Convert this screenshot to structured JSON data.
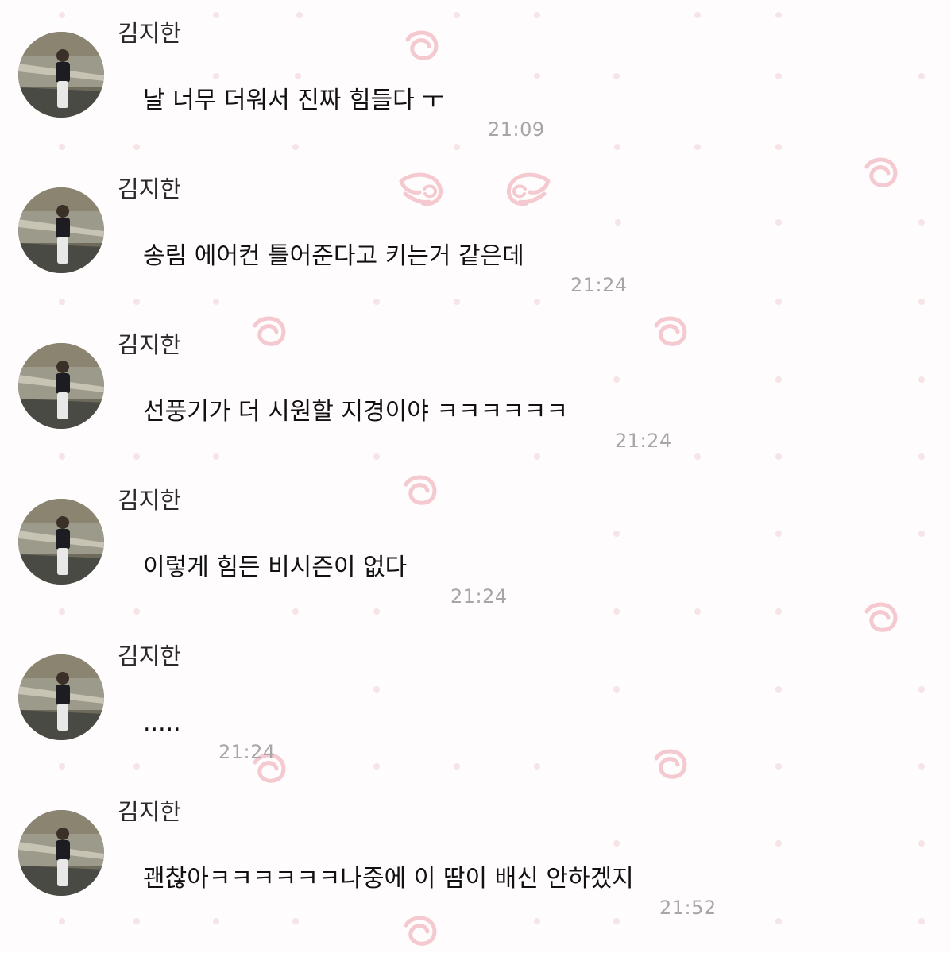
{
  "theme": {
    "background": "#fefcfc",
    "pattern_color": "#f4c9cf",
    "dot_color": "#f6e4e7",
    "timestamp_color": "#a6a6a6"
  },
  "messages": [
    {
      "sender": "김지한",
      "avatar": "profile-photo-icon",
      "text": "날 너무 더워서 진짜 힘들다 ㅜ",
      "time": "21:09"
    },
    {
      "sender": "김지한",
      "avatar": "profile-photo-icon",
      "text": "송림 에어컨 틀어준다고 키는거 같은데",
      "time": "21:24"
    },
    {
      "sender": "김지한",
      "avatar": "profile-photo-icon",
      "text": "선풍기가 더 시원할 지경이야 ㅋㅋㅋㅋㅋㅋ",
      "time": "21:24"
    },
    {
      "sender": "김지한",
      "avatar": "profile-photo-icon",
      "text": "이렇게 힘든 비시즌이 없다",
      "time": "21:24"
    },
    {
      "sender": "김지한",
      "avatar": "profile-photo-icon",
      "text": ".....",
      "time": "21:24"
    },
    {
      "sender": "김지한",
      "avatar": "profile-photo-icon",
      "text": "괜찮아ㅋㅋㅋㅋㅋㅋ나중에 이 땀이 배신 안하겠지",
      "time": "21:52"
    }
  ]
}
